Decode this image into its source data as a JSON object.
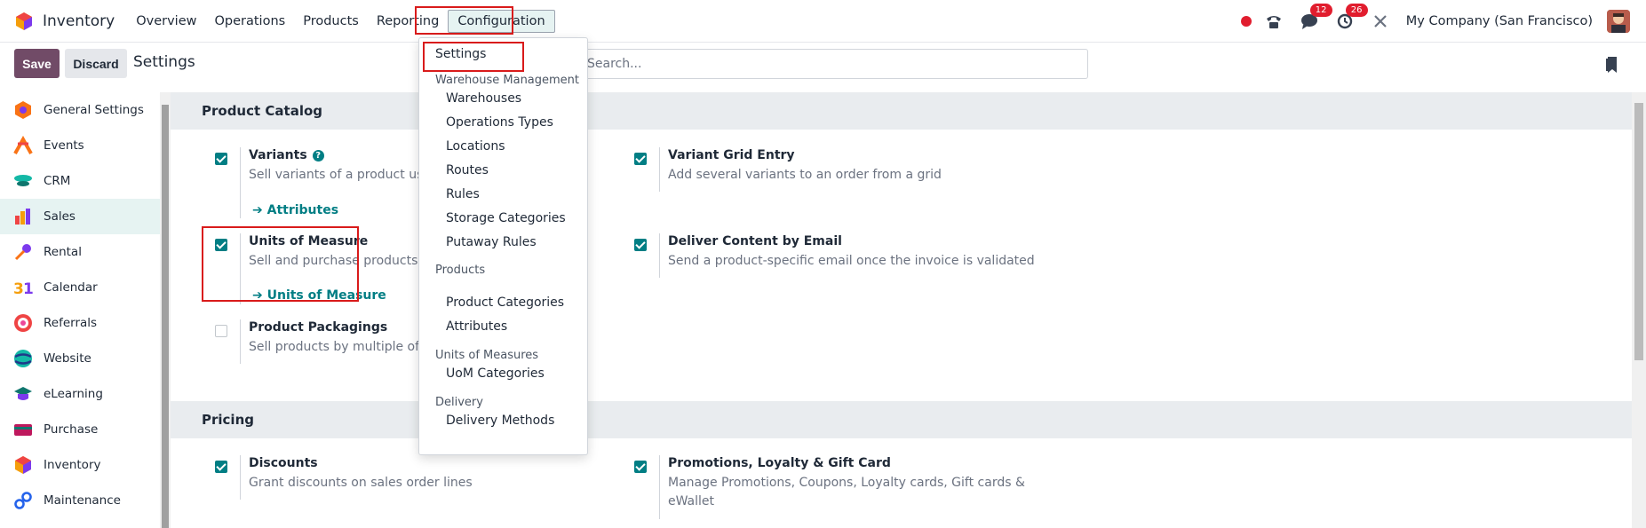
{
  "app": {
    "name": "Inventory"
  },
  "nav": {
    "items": [
      "Overview",
      "Operations",
      "Products",
      "Reporting",
      "Configuration"
    ],
    "active": "Configuration"
  },
  "systray": {
    "messages_count": "12",
    "activities_count": "26",
    "company": "My Company (San Francisco)"
  },
  "control": {
    "save_label": "Save",
    "discard_label": "Discard",
    "title": "Settings",
    "search_placeholder": "Search..."
  },
  "sidebar": {
    "items": [
      {
        "label": "General Settings",
        "icon": "general-settings-icon"
      },
      {
        "label": "Events",
        "icon": "events-icon"
      },
      {
        "label": "CRM",
        "icon": "crm-icon"
      },
      {
        "label": "Sales",
        "icon": "sales-icon",
        "active": true
      },
      {
        "label": "Rental",
        "icon": "rental-icon"
      },
      {
        "label": "Calendar",
        "icon": "calendar-icon"
      },
      {
        "label": "Referrals",
        "icon": "referrals-icon"
      },
      {
        "label": "Website",
        "icon": "website-icon"
      },
      {
        "label": "eLearning",
        "icon": "elearning-icon"
      },
      {
        "label": "Purchase",
        "icon": "purchase-icon"
      },
      {
        "label": "Inventory",
        "icon": "inventory-icon"
      },
      {
        "label": "Maintenance",
        "icon": "maintenance-icon"
      }
    ]
  },
  "sections": {
    "product_catalog": {
      "title": "Product Catalog",
      "variants": {
        "title": "Variants",
        "desc": "Sell variants of a product using",
        "link": "Attributes",
        "checked": true
      },
      "variant_grid": {
        "title": "Variant Grid Entry",
        "desc": "Add several variants to an order from a grid",
        "checked": true
      },
      "uom": {
        "title": "Units of Measure",
        "desc": "Sell and purchase products in d",
        "link": "Units of Measure",
        "checked": true
      },
      "deliver_email": {
        "title": "Deliver Content by Email",
        "desc": "Send a product-specific email once the invoice is validated",
        "checked": true
      },
      "packagings": {
        "title": "Product Packagings",
        "desc": "Sell products by multiple of un",
        "checked": false
      }
    },
    "pricing": {
      "title": "Pricing",
      "discounts": {
        "title": "Discounts",
        "desc": "Grant discounts on sales order lines",
        "checked": true
      },
      "promotions": {
        "title": "Promotions, Loyalty & Gift Card",
        "desc_line1": "Manage Promotions, Coupons, Loyalty cards, Gift cards &",
        "desc_line2": "eWallet",
        "checked": true
      }
    }
  },
  "dropdown": {
    "settings": "Settings",
    "groups": {
      "warehouse": "Warehouse Management",
      "warehouse_items": [
        "Warehouses",
        "Operations Types",
        "Locations",
        "Routes",
        "Rules",
        "Storage Categories",
        "Putaway Rules"
      ],
      "products": "Products",
      "products_items": [
        "Product Categories",
        "Attributes"
      ],
      "uom": "Units of Measures",
      "uom_items": [
        "UoM Categories"
      ],
      "delivery": "Delivery",
      "delivery_items": [
        "Delivery Methods"
      ]
    }
  },
  "colors": {
    "brand": "#714b67",
    "accent": "#017e84",
    "highlight": "#d91b1b"
  }
}
